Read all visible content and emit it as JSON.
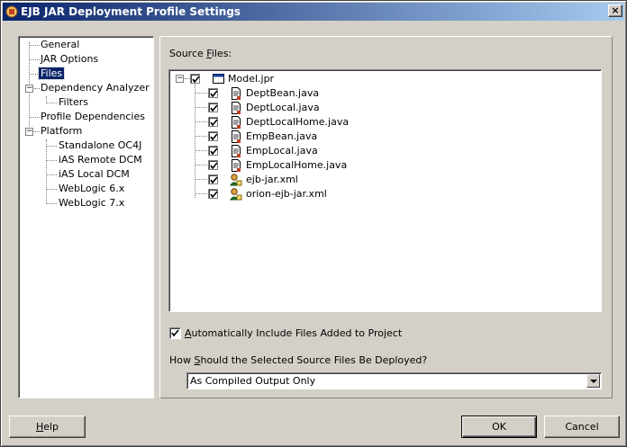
{
  "window": {
    "title": "EJB JAR Deployment Profile Settings",
    "close_label": "×"
  },
  "nav": {
    "items": [
      {
        "label": "General"
      },
      {
        "label": "JAR Options"
      },
      {
        "label": "Files",
        "selected": true
      },
      {
        "label": "Dependency Analyzer",
        "expanded": true
      },
      {
        "label": "Filters"
      },
      {
        "label": "Profile Dependencies"
      },
      {
        "label": "Platform",
        "expanded": true
      },
      {
        "label": "Standalone OC4J"
      },
      {
        "label": "iAS Remote DCM"
      },
      {
        "label": "iAS Local DCM"
      },
      {
        "label": "WebLogic 6.x"
      },
      {
        "label": "WebLogic 7.x"
      }
    ]
  },
  "source_files": {
    "label_pre": "Source ",
    "label_mnemonic": "F",
    "label_post": "iles:",
    "root": {
      "name": "Model.jpr",
      "checked": true,
      "icon": "project-icon"
    },
    "files": [
      {
        "name": "DeptBean.java",
        "checked": true,
        "icon": "java-file-icon"
      },
      {
        "name": "DeptLocal.java",
        "checked": true,
        "icon": "java-file-icon"
      },
      {
        "name": "DeptLocalHome.java",
        "checked": true,
        "icon": "java-file-icon"
      },
      {
        "name": "EmpBean.java",
        "checked": true,
        "icon": "java-file-icon"
      },
      {
        "name": "EmpLocal.java",
        "checked": true,
        "icon": "java-file-icon"
      },
      {
        "name": "EmpLocalHome.java",
        "checked": true,
        "icon": "java-file-icon"
      },
      {
        "name": "ejb-jar.xml",
        "checked": true,
        "icon": "xml-file-icon"
      },
      {
        "name": "orion-ejb-jar.xml",
        "checked": true,
        "icon": "xml-file-icon"
      }
    ]
  },
  "auto_include": {
    "checked": true,
    "label_mnemonic": "A",
    "label_rest": "utomatically Include Files Added to Project"
  },
  "deploy": {
    "label_pre": "How ",
    "label_mnemonic": "S",
    "label_post": "hould the Selected Source Files Be Deployed?",
    "selected": "As Compiled Output Only"
  },
  "buttons": {
    "help_mnemonic": "H",
    "help_rest": "elp",
    "ok": "OK",
    "cancel": "Cancel"
  },
  "colors": {
    "title_start": "#0a246a",
    "title_end": "#a6caf0",
    "selection": "#0a246a",
    "face": "#d4d0c8"
  }
}
